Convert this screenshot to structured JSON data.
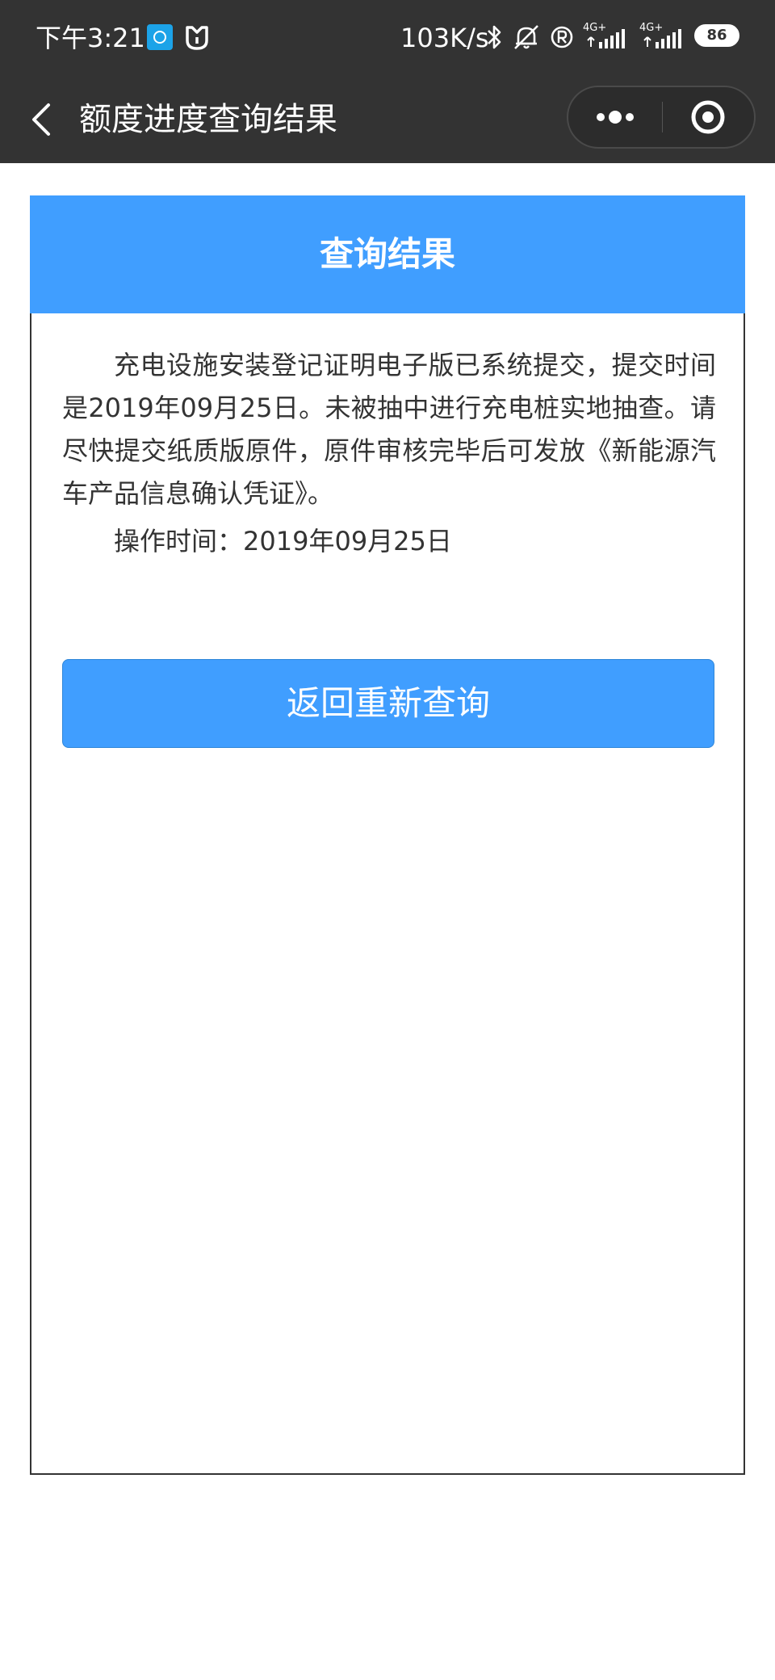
{
  "status_bar": {
    "time": "下午3:21",
    "net_speed": "103K/s",
    "network_1": "4G+",
    "network_2": "4G+",
    "battery": "86",
    "icons": [
      "app-notification-icon",
      "mi-home-icon",
      "bluetooth-icon",
      "mute-icon",
      "registered-icon",
      "signal-icon",
      "signal-icon",
      "battery-icon"
    ]
  },
  "nav_bar": {
    "title": "额度进度查询结果",
    "back_icon": "chevron-left-icon",
    "more_icon": "more-dots-icon",
    "close_icon": "target-close-icon"
  },
  "card": {
    "header": "查询结果",
    "result_text": "充电设施安装登记证明电子版已系统提交，提交时间是2019年09月25日。未被抽中进行充电桩实地抽查。请尽快提交纸质版原件，原件审核完毕后可发放《新能源汽车产品信息确认凭证》。",
    "op_time_label": "操作时间：",
    "op_time_value": "2019年09月25日",
    "requery_button": "返回重新查询"
  },
  "colors": {
    "bar_background": "#333333",
    "accent_blue": "#409eff",
    "text": "#333333"
  }
}
